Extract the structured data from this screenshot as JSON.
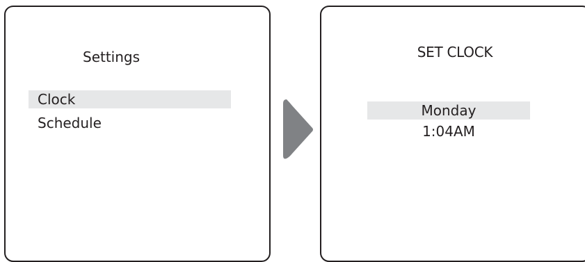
{
  "left_screen": {
    "title": "Settings",
    "menu_items": [
      {
        "label": "Clock",
        "selected": true
      },
      {
        "label": "Schedule",
        "selected": false
      }
    ]
  },
  "right_screen": {
    "title": "SET CLOCK",
    "day": "Monday",
    "time": "1:04AM"
  },
  "arrow": {
    "icon": "chevron-right-icon",
    "color": "#808285"
  },
  "colors": {
    "outline": "#231f20",
    "selection_highlight": "#e6e7e8",
    "background": "#ffffff"
  }
}
